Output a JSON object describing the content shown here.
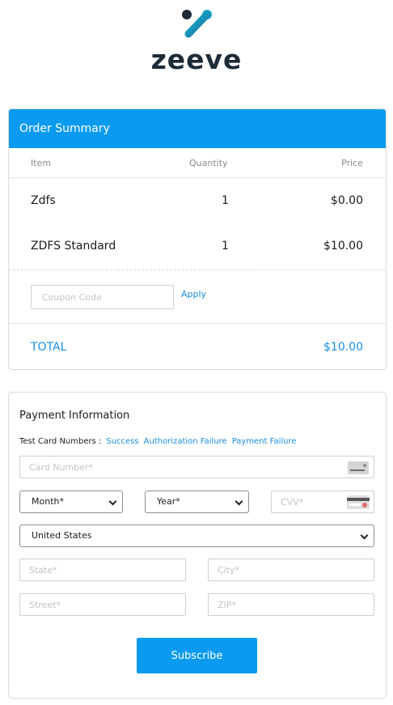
{
  "brand": {
    "name": "zeeve",
    "accent": "#0a9bf0",
    "link": "#1a8ee0"
  },
  "order": {
    "header": "Order Summary",
    "columns": {
      "item": "Item",
      "quantity": "Quantity",
      "price": "Price"
    },
    "items": [
      {
        "name": "Zdfs",
        "quantity": "1",
        "price": "$0.00"
      },
      {
        "name": "ZDFS Standard",
        "quantity": "1",
        "price": "$10.00"
      }
    ],
    "coupon": {
      "placeholder": "Coupon Code",
      "apply_label": "Apply"
    },
    "total": {
      "label": "TOTAL",
      "value": "$10.00"
    }
  },
  "payment": {
    "title": "Payment Information",
    "test_cards": {
      "label": "Test Card Numbers :",
      "links": [
        "Success",
        "Authorization Failure",
        "Payment Failure"
      ]
    },
    "card_number_placeholder": "Card Number*",
    "month": "Month*",
    "year": "Year*",
    "cvv_placeholder": "CVV*",
    "country": "United States",
    "state_placeholder": "State*",
    "city_placeholder": "City*",
    "street_placeholder": "Street*",
    "zip_placeholder": "ZIP*",
    "subscribe_label": "Subscribe"
  },
  "icons": {
    "logo": "zeeve-logo-icon",
    "card": "credit-card-icon",
    "cvv": "cvv-card-icon",
    "dropdown": "chevron-down-icon"
  }
}
